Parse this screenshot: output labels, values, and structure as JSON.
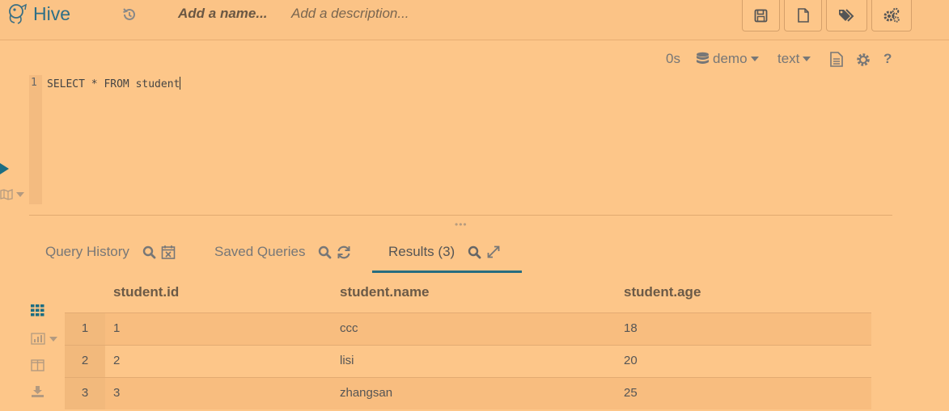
{
  "app": {
    "title": "Hive",
    "name_placeholder": "Add a name...",
    "description_placeholder": "Add a description..."
  },
  "editor_toolbar": {
    "duration": "0s",
    "database": "demo",
    "format": "text"
  },
  "editor": {
    "line_number": "1",
    "code": "SELECT * FROM student"
  },
  "tabs": [
    {
      "label": "Query History"
    },
    {
      "label": "Saved Queries"
    },
    {
      "label": "Results (3)"
    }
  ],
  "results": {
    "columns": [
      "student.id",
      "student.name",
      "student.age"
    ],
    "rows": [
      {
        "num": "1",
        "id": "1",
        "name": "ccc",
        "age": "18"
      },
      {
        "num": "2",
        "id": "2",
        "name": "lisi",
        "age": "20"
      },
      {
        "num": "3",
        "id": "3",
        "name": "zhangsan",
        "age": "25"
      }
    ]
  },
  "icons": {
    "header": [
      "hive-logo-icon",
      "history-icon",
      "save-icon",
      "new-document-icon",
      "tags-icon",
      "settings-cogs-icon"
    ],
    "editor_toolbar": [
      "database-icon",
      "document-icon",
      "gear-icon",
      "help-icon"
    ],
    "results_side": [
      "grid-icon",
      "chart-icon",
      "columns-icon",
      "download-icon"
    ]
  },
  "colors": {
    "background": "#fdc689",
    "accent": "#276d80",
    "title": "#2e6f87"
  }
}
